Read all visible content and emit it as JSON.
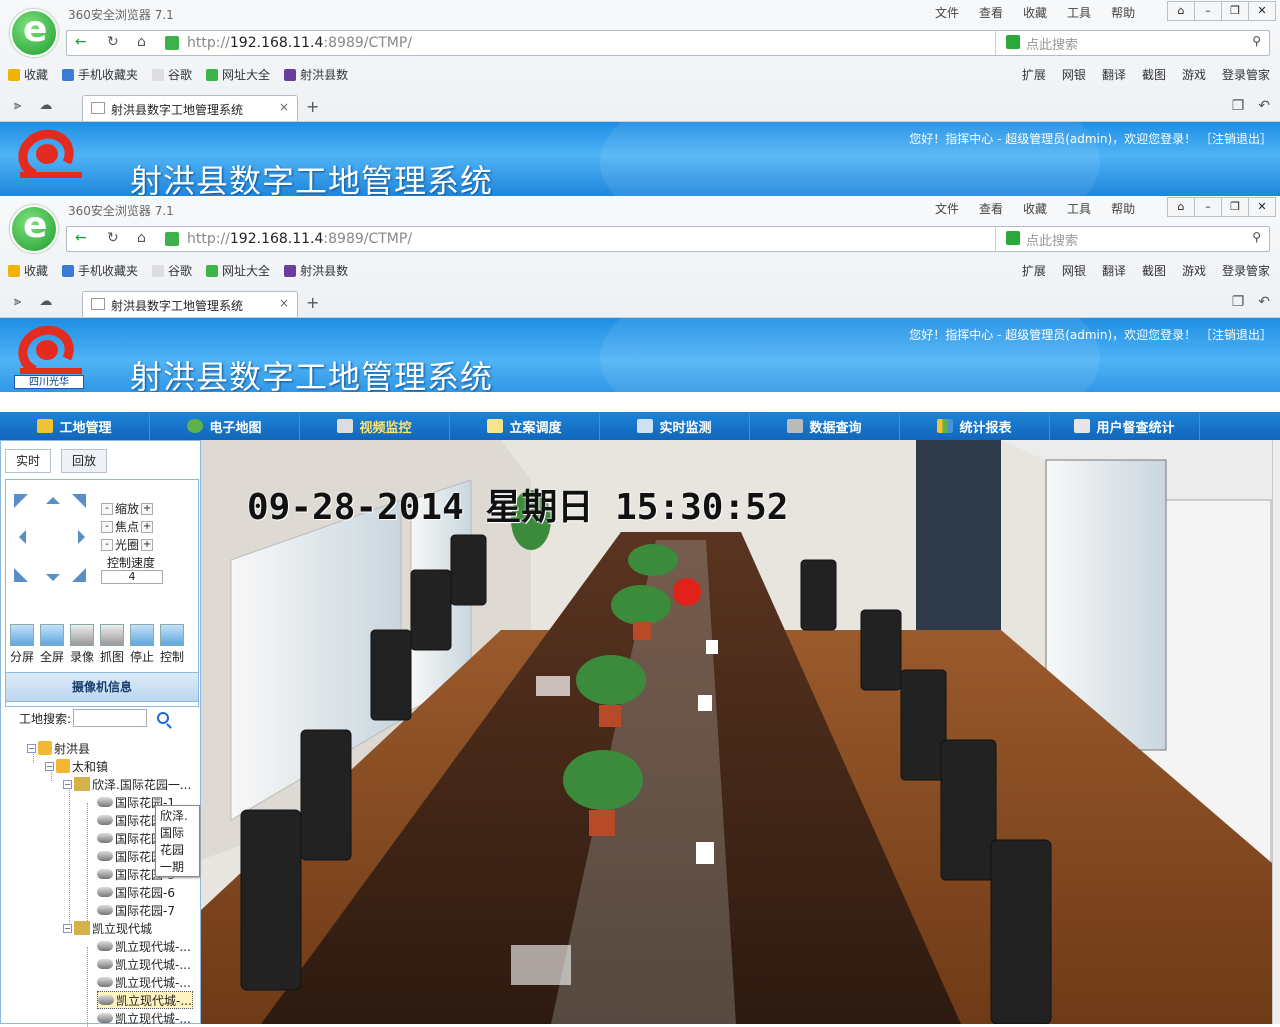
{
  "browser": {
    "title": "360安全浏览器 7.1",
    "menu": [
      "文件",
      "查看",
      "收藏",
      "工具",
      "帮助"
    ],
    "url_prefix": "http://",
    "url_host": "192.168.11.4",
    "url_rest": ":8989/CTMP/",
    "search_placeholder": "点此搜索",
    "favorites": [
      "收藏",
      "手机收藏夹",
      "谷歌",
      "网址大全",
      "射洪县数"
    ],
    "right_tools": [
      "扩展",
      "网银",
      "翻译",
      "截图",
      "游戏",
      "登录管家"
    ],
    "tab_title": "射洪县数字工地管理系统"
  },
  "app": {
    "title": "射洪县数字工地管理系统",
    "logo_text": "四川光华",
    "welcome": "您好！指挥中心 - 超级管理员(admin)，欢迎您登录！ ［注销退出］",
    "nav": [
      "工地管理",
      "电子地图",
      "视频监控",
      "立案调度",
      "实时监测",
      "数据查询",
      "统计报表",
      "用户督查统计"
    ],
    "active_nav": "视频监控"
  },
  "left": {
    "tabs": [
      "实时",
      "回放"
    ],
    "ptz": {
      "zoom": "缩放",
      "focus": "焦点",
      "iris": "光圈",
      "speed_label": "控制速度",
      "speed": "4"
    },
    "tools": [
      "分屏",
      "全屏",
      "录像",
      "抓图",
      "停止",
      "控制"
    ],
    "cam_header": "摄像机信息",
    "search_label": "工地搜索:",
    "tree": [
      "射洪县",
      "太和镇",
      "欣泽.国际花园一...",
      "国际花园-1",
      "国际花园-2",
      "国际花园-3",
      "国际花园-4",
      "国际花园-5",
      "国际花园-6",
      "国际花园-7",
      "凯立现代城",
      "凯立现代城-...",
      "凯立现代城-...",
      "凯立现代城-...",
      "凯立现代城-...",
      "凯立现代城-..."
    ],
    "tooltip": "欣泽.国际花园一期"
  },
  "video": {
    "timestamp": "09-28-2014 星期日 15:30:52"
  }
}
